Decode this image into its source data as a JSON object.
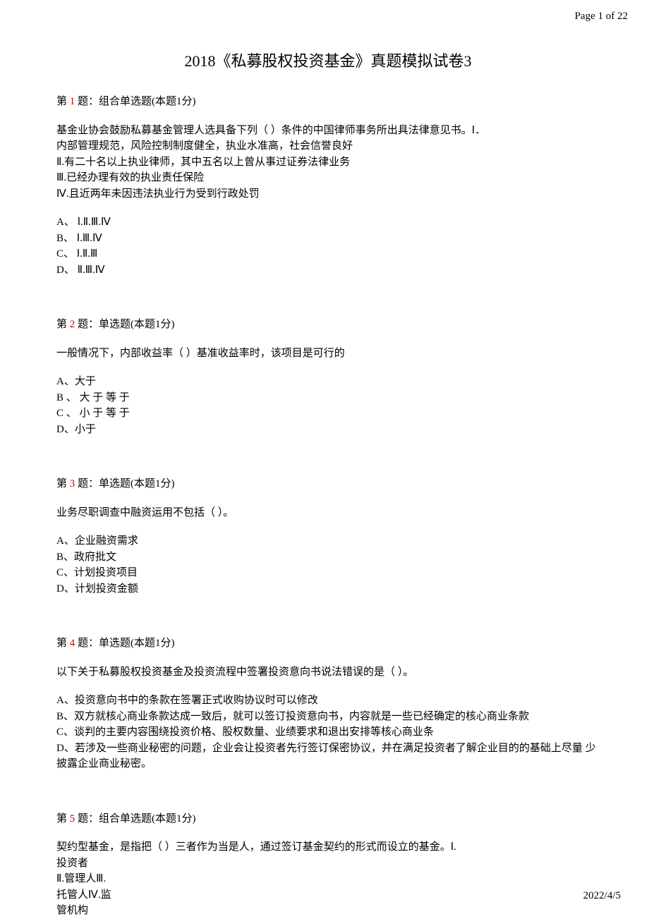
{
  "page_header": "Page 1 of 22",
  "page_footer": "2022/4/5",
  "title": "2018《私募股权投资基金》真题模拟试卷3",
  "questions": [
    {
      "label_prefix": "第 ",
      "number": "1",
      "label_suffix": " 题：组合单选题(本题1分)",
      "body": [
        "基金业协会鼓励私募基金管理人选具备下列（     ）条件的中国律师事务所出具法律意见书。Ⅰ．",
        "内部管理规范，风险控制制度健全，执业水准高，社会信誉良好",
        "Ⅱ.有二十名以上执业律师，其中五名以上曾从事过证券法律业务",
        "Ⅲ.已经办理有效的执业责任保险",
        "Ⅳ.且近两年未因违法执业行为受到行政处罚"
      ],
      "options": [
        "A、 Ⅰ.Ⅱ.Ⅲ.Ⅳ",
        "B、 Ⅰ.Ⅲ.Ⅳ",
        "C、 Ⅰ.Ⅱ.Ⅲ",
        "D、 Ⅱ.Ⅲ.Ⅳ"
      ]
    },
    {
      "label_prefix": "第 ",
      "number": "2",
      "label_suffix": " 题：单选题(本题1分)",
      "body": [
        "一般情况下，内部收益率（   ）基准收益率时，该项目是可行的"
      ],
      "options": [
        "A、大于",
        "B 、 大 于 等 于",
        "C 、 小 于 等 于",
        "D、小于"
      ]
    },
    {
      "label_prefix": "第 ",
      "number": "3",
      "label_suffix": " 题：单选题(本题1分)",
      "body": [
        "业务尽职调查中融资运用不包括（   ）。"
      ],
      "options": [
        "A、企业融资需求",
        "B、政府批文",
        "C、计划投资项目",
        "D、计划投资金额"
      ]
    },
    {
      "label_prefix": "第 ",
      "number": "4",
      "label_suffix": " 题：单选题(本题1分)",
      "body": [
        "以下关于私募股权投资基金及投资流程中签署投资意向书说法错误的是（   ）。"
      ],
      "options": [
        "A、投资意向书中的条款在签署正式收购协议时可以修改",
        "B、双方就核心商业条款达成一致后，就可以签订投资意向书，内容就是一些已经确定的核心商业条款",
        "C、谈判的主要内容围绕投资价格、股权数量、业绩要求和退出安排等核心商业条",
        "D、若涉及一些商业秘密的问题，企业会让投资者先行签订保密协议，并在满足投资者了解企业目的的基础上尽量  少披露企业商业秘密。"
      ]
    },
    {
      "label_prefix": "第 ",
      "number": "5",
      "label_suffix": " 题：组合单选题(本题1分)",
      "body": [
        "契约型基金，是指把（     ）三者作为当是人，通过签订基金契约的形式而设立的基金。Ⅰ.",
        "投资者",
        "Ⅱ.管理人Ⅲ.",
        "托管人Ⅳ.监",
        "管机构"
      ],
      "options": []
    }
  ]
}
